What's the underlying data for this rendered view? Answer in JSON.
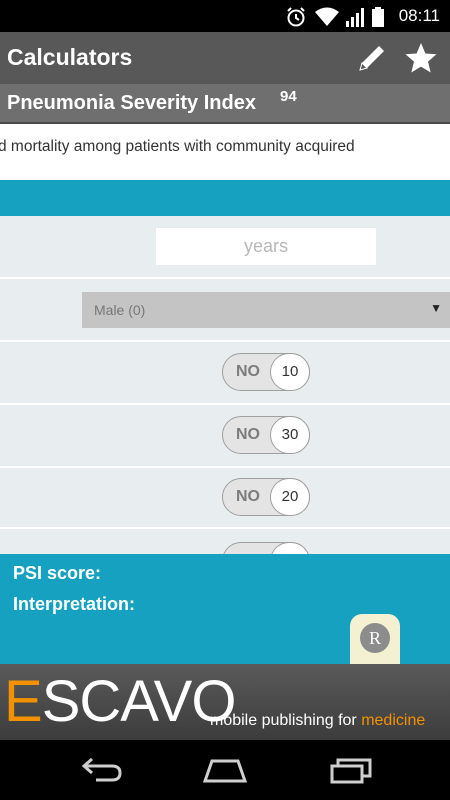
{
  "status": {
    "time": "08:11"
  },
  "appbar": {
    "title": "Calculators"
  },
  "calculator": {
    "title": "Pneumonia Severity Index",
    "superscript": "94"
  },
  "description": "d mortality among patients with community acquired",
  "form": {
    "age_placeholder": "years",
    "sex_value": "Male (0)",
    "toggles": [
      {
        "label": "NO",
        "points": "10"
      },
      {
        "label": "NO",
        "points": "30"
      },
      {
        "label": "NO",
        "points": "20"
      },
      {
        "label": "NO",
        "points": ""
      }
    ]
  },
  "result": {
    "score_label": "PSI score:",
    "interpretation_label": "Interpretation:"
  },
  "badge": {
    "letter": "R"
  },
  "banner": {
    "logo_first": "E",
    "logo_rest": "SCAVO",
    "tagline_prefix": "mobile publishing for ",
    "tagline_highlight": "medicine"
  },
  "colors": {
    "teal": "#17a1c1",
    "orange": "#f39200",
    "appbar": "#585858"
  }
}
